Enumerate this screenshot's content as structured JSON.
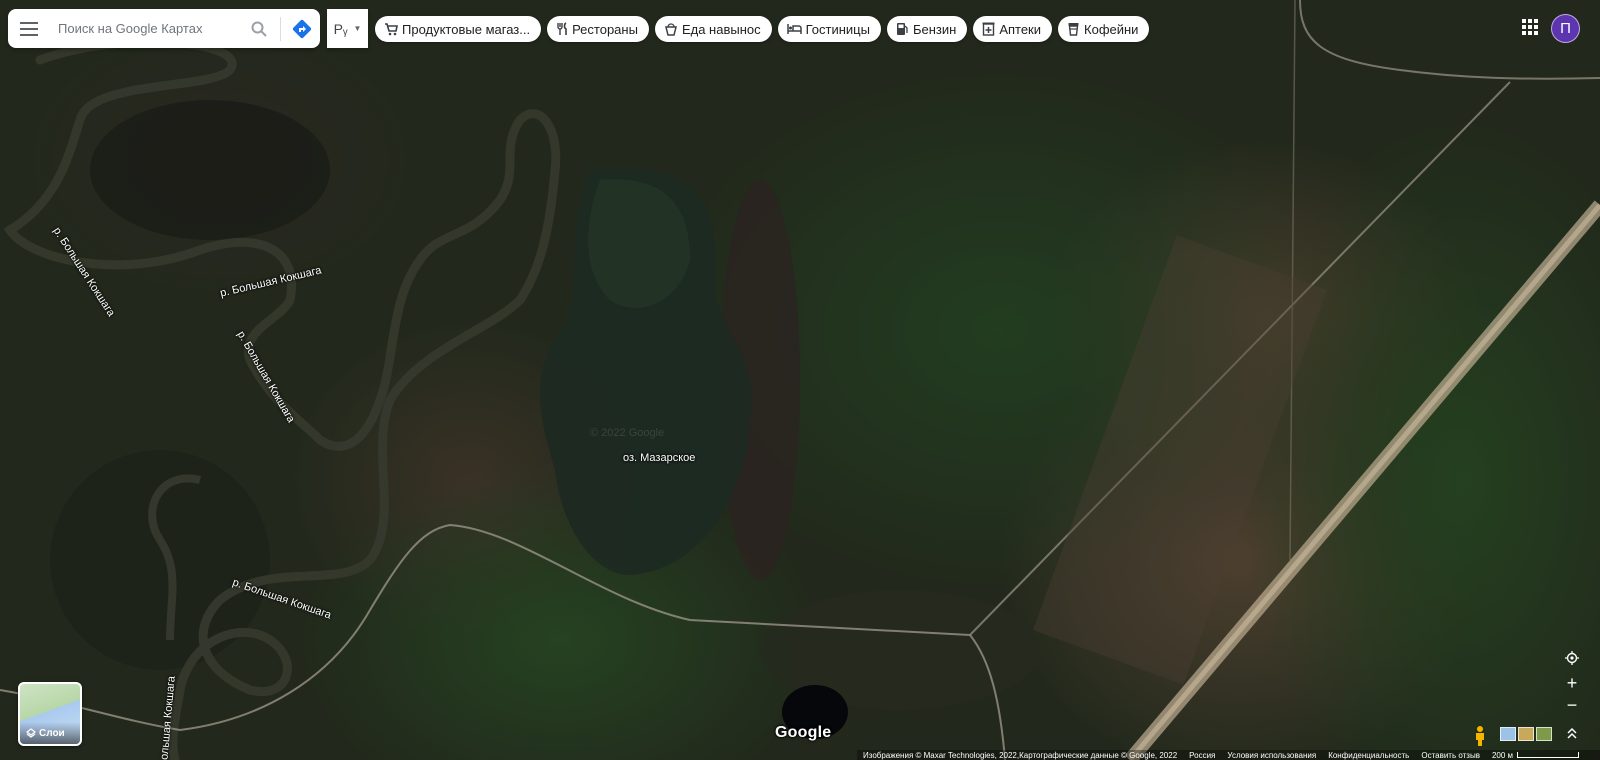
{
  "search": {
    "placeholder": "Поиск на Google Картах"
  },
  "translit": {
    "label": "Pᵧ"
  },
  "chips": [
    {
      "label": "Продуктовые магаз...",
      "icon": "cart-icon"
    },
    {
      "label": "Рестораны",
      "icon": "fork-knife-icon"
    },
    {
      "label": "Еда навынос",
      "icon": "takeout-icon"
    },
    {
      "label": "Гостиницы",
      "icon": "bed-icon"
    },
    {
      "label": "Бензин",
      "icon": "gas-pump-icon"
    },
    {
      "label": "Аптеки",
      "icon": "pharmacy-icon"
    },
    {
      "label": "Кофейни",
      "icon": "coffee-cup-icon"
    }
  ],
  "account": {
    "initial": "П",
    "color": "#5e35b1"
  },
  "map": {
    "labels": {
      "lake": "оз. Мазарское",
      "river": "р. Большая Кокшага",
      "river_bottom": "ольшая Кокшага"
    },
    "watermark": "© 2022 Google",
    "logo": "Google"
  },
  "layers": {
    "label": "Слои"
  },
  "controls": {
    "zoom_in": "+",
    "zoom_out": "−"
  },
  "footer": {
    "imagery": "Изображения © Maxar Technologies, 2022,Картографические данные © Google, 2022",
    "country": "Россия",
    "terms": "Условия использования",
    "privacy": "Конфиденциальность",
    "feedback": "Оставить отзыв",
    "scale": "200 м"
  }
}
